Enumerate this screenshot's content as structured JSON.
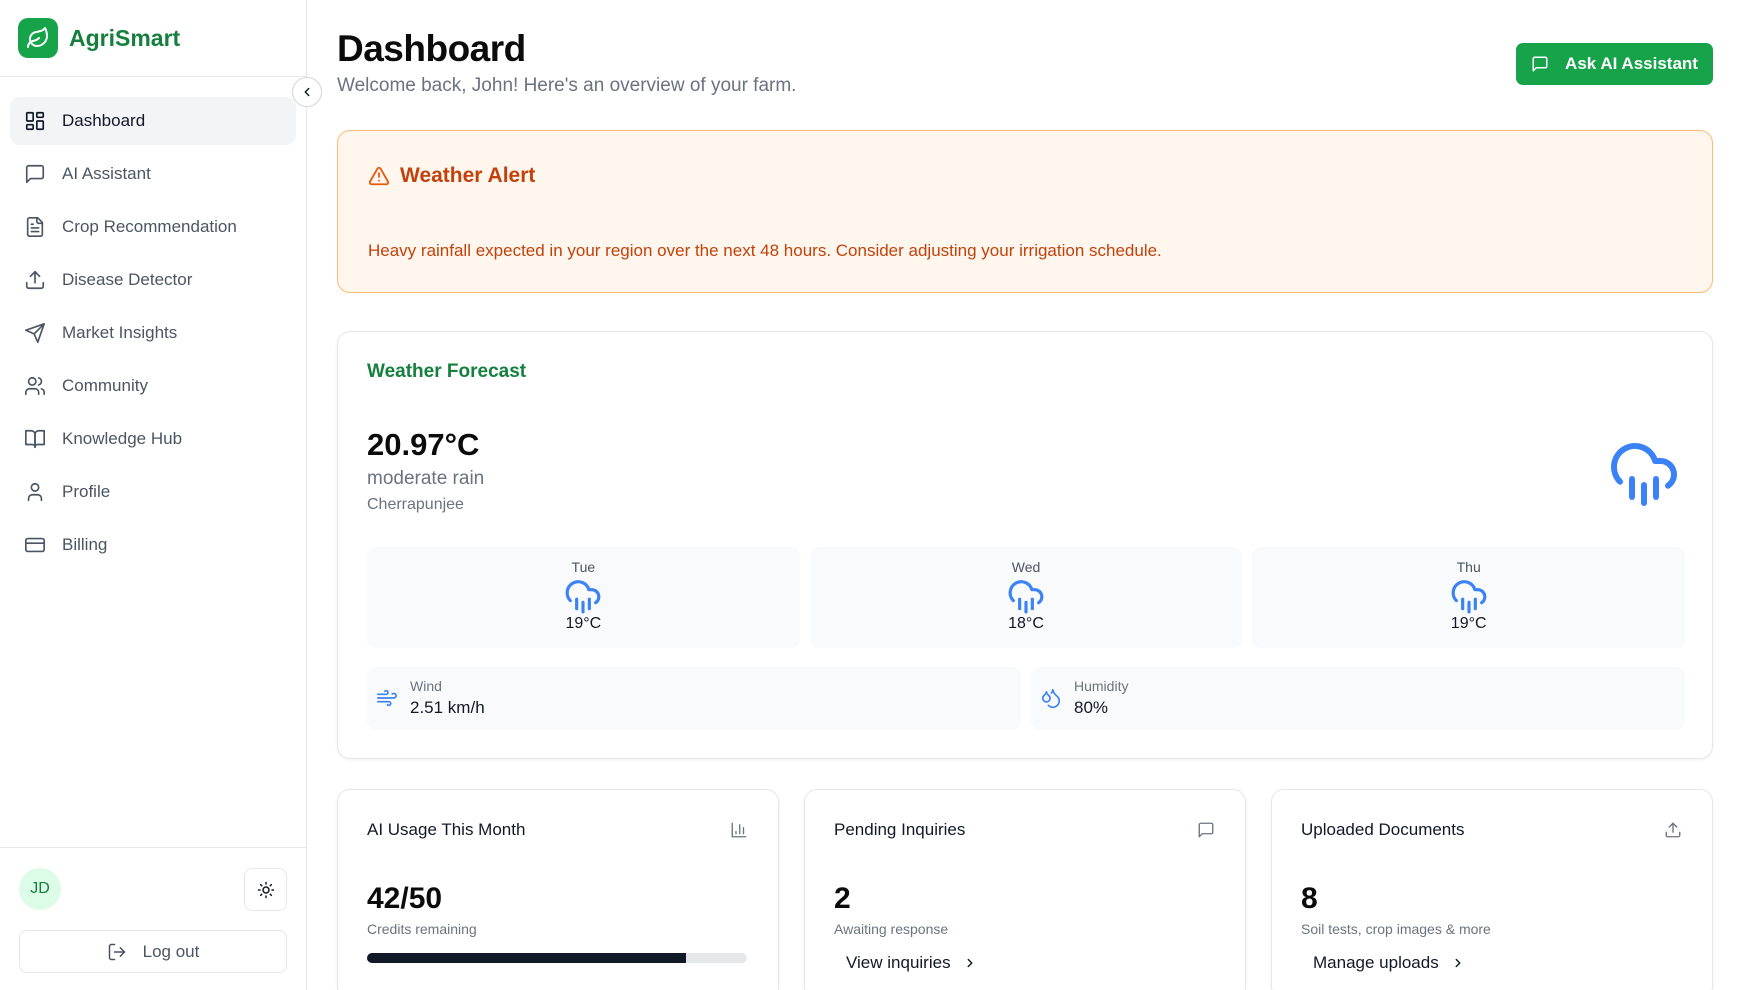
{
  "brand": {
    "name": "AgriSmart",
    "accent": "#16a34a"
  },
  "sidebar": {
    "items": [
      {
        "label": "Dashboard",
        "icon": "layout-grid-icon",
        "active": true
      },
      {
        "label": "AI Assistant",
        "icon": "message-square-icon"
      },
      {
        "label": "Crop Recommendation",
        "icon": "file-text-icon"
      },
      {
        "label": "Disease Detector",
        "icon": "upload-icon"
      },
      {
        "label": "Market Insights",
        "icon": "send-icon"
      },
      {
        "label": "Community",
        "icon": "users-icon"
      },
      {
        "label": "Knowledge Hub",
        "icon": "book-open-icon"
      },
      {
        "label": "Profile",
        "icon": "user-icon"
      },
      {
        "label": "Billing",
        "icon": "credit-card-icon"
      }
    ],
    "user_initials": "JD",
    "logout_label": "Log out"
  },
  "header": {
    "title": "Dashboard",
    "subtitle": "Welcome back, John! Here's an overview of your farm.",
    "ask_button": "Ask AI Assistant"
  },
  "alert": {
    "title": "Weather Alert",
    "message": "Heavy rainfall expected in your region over the next 48 hours. Consider adjusting your irrigation schedule."
  },
  "forecast": {
    "title": "Weather Forecast",
    "temperature": "20.97°C",
    "condition": "moderate rain",
    "location": "Cherrapunjee",
    "days": [
      {
        "day": "Tue",
        "temp": "19°C"
      },
      {
        "day": "Wed",
        "temp": "18°C"
      },
      {
        "day": "Thu",
        "temp": "19°C"
      }
    ],
    "wind": {
      "label": "Wind",
      "value": "2.51 km/h"
    },
    "humidity": {
      "label": "Humidity",
      "value": "80%"
    }
  },
  "cards": {
    "usage": {
      "title": "AI Usage This Month",
      "value": "42/50",
      "sub": "Credits remaining",
      "progress": 0.84
    },
    "inquiries": {
      "title": "Pending Inquiries",
      "value": "2",
      "sub": "Awaiting response",
      "link": "View inquiries"
    },
    "documents": {
      "title": "Uploaded Documents",
      "value": "8",
      "sub": "Soil tests, crop images & more",
      "link": "Manage uploads"
    }
  }
}
